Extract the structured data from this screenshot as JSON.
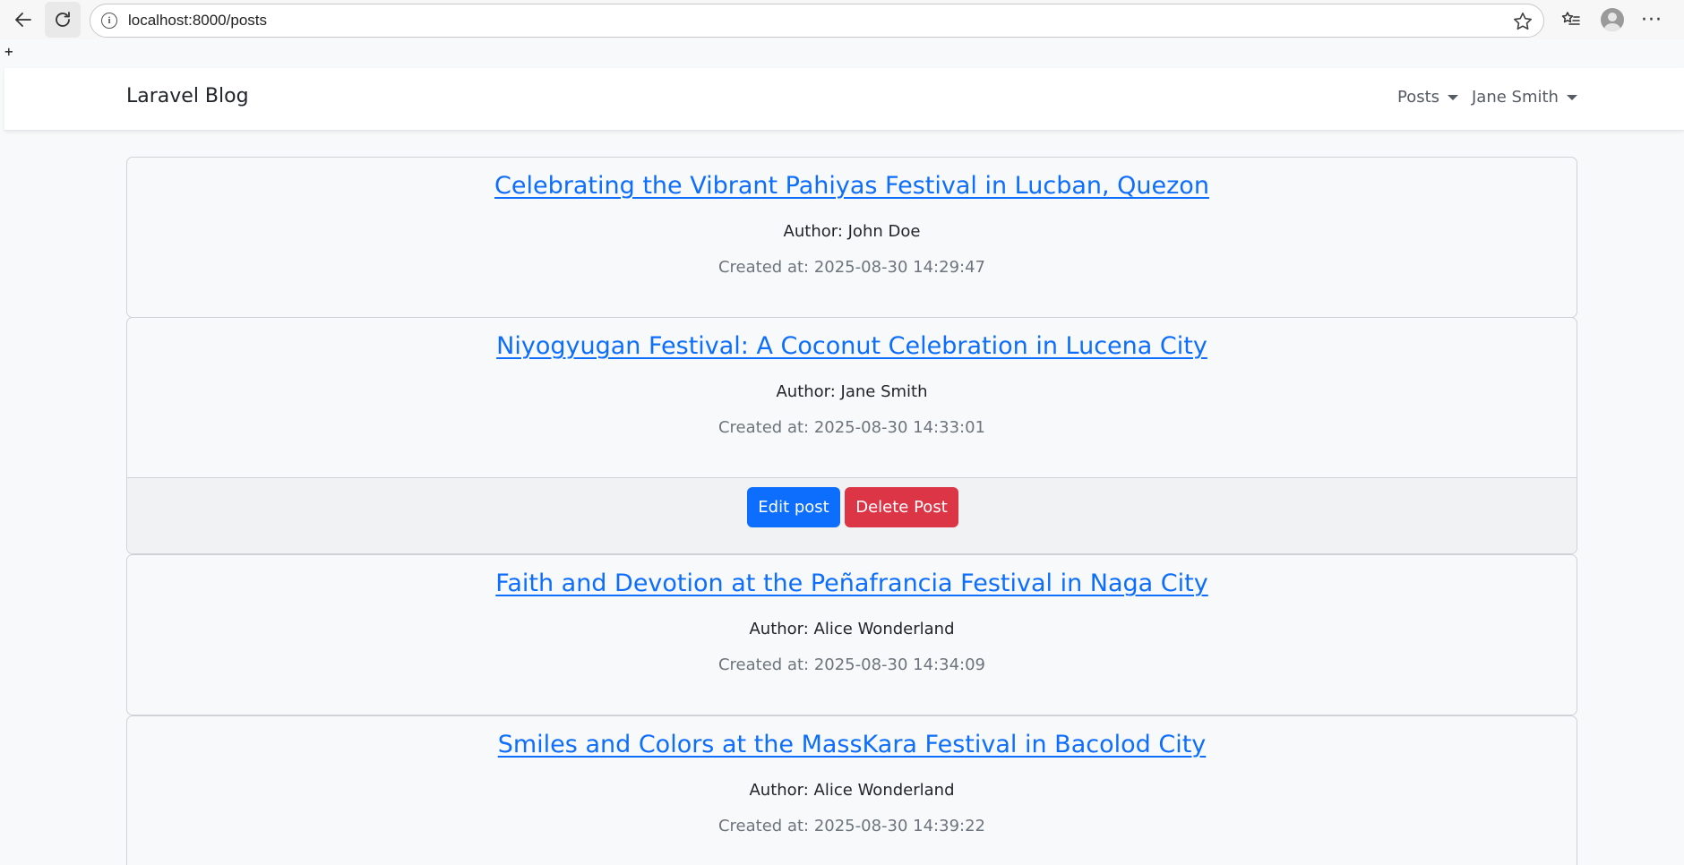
{
  "browser": {
    "url": "localhost:8000/posts",
    "plus_glyph": "+"
  },
  "navbar": {
    "brand": "Laravel Blog",
    "posts_menu": "Posts",
    "user_menu": "Jane Smith"
  },
  "posts": [
    {
      "title": "Celebrating the Vibrant Pahiyas Festival in Lucban, Quezon",
      "author": "Author: John Doe",
      "created": "Created at: 2025-08-30 14:29:47"
    },
    {
      "title": "Niyogyugan Festival: A Coconut Celebration in Lucena City",
      "author": "Author: Jane Smith",
      "created": "Created at: 2025-08-30 14:33:01",
      "edit_label": "Edit post",
      "delete_label": "Delete Post"
    },
    {
      "title": "Faith and Devotion at the Peñafrancia Festival in Naga City",
      "author": "Author: Alice Wonderland",
      "created": "Created at: 2025-08-30 14:34:09"
    },
    {
      "title": "Smiles and Colors at the MassKara Festival in Bacolod City",
      "author": "Author: Alice Wonderland",
      "created": "Created at: 2025-08-30 14:39:22"
    }
  ],
  "colors": {
    "link": "#0d6efd",
    "edit_button": "#0d6efd",
    "delete_button": "#dc3545"
  }
}
